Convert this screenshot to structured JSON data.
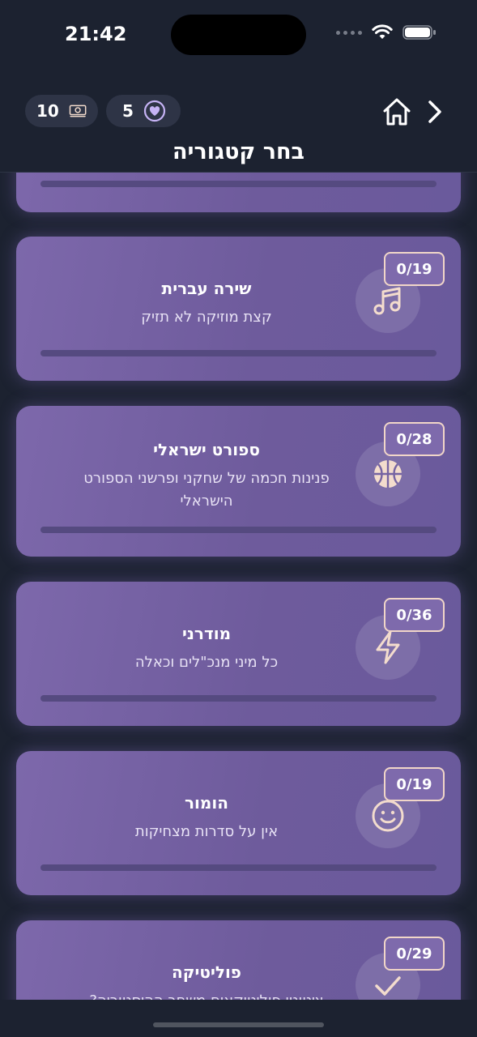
{
  "status": {
    "time": "21:42"
  },
  "header": {
    "money_count": "10",
    "lives_count": "5",
    "title": "בחר קטגוריה"
  },
  "colors": {
    "background": "#1c2230",
    "card": "#7563a2",
    "badge_border": "#f1d6c8",
    "icon": "#f3dccd"
  },
  "categories": [
    {
      "title": "שירה עברית",
      "desc": "קצת מוזיקה לא תזיק",
      "progress": "0/19",
      "icon": "music-note-icon"
    },
    {
      "title": "ספורט ישראלי",
      "desc": "פנינות חכמה של שחקני ופרשני הספורט הישראלי",
      "progress": "0/28",
      "icon": "basketball-icon"
    },
    {
      "title": "מודרני",
      "desc": "כל מיני מנכ\"לים וכאלה",
      "progress": "0/36",
      "icon": "lightning-icon"
    },
    {
      "title": "הומור",
      "desc": "אין על סדרות מצחיקות",
      "progress": "0/19",
      "icon": "smiley-icon"
    },
    {
      "title": "פוליטיקה",
      "desc": "ציטוטי פוליטיקאים משחר ההיסטוריה?",
      "progress": "0/29",
      "icon": "checkmark-icon"
    }
  ]
}
